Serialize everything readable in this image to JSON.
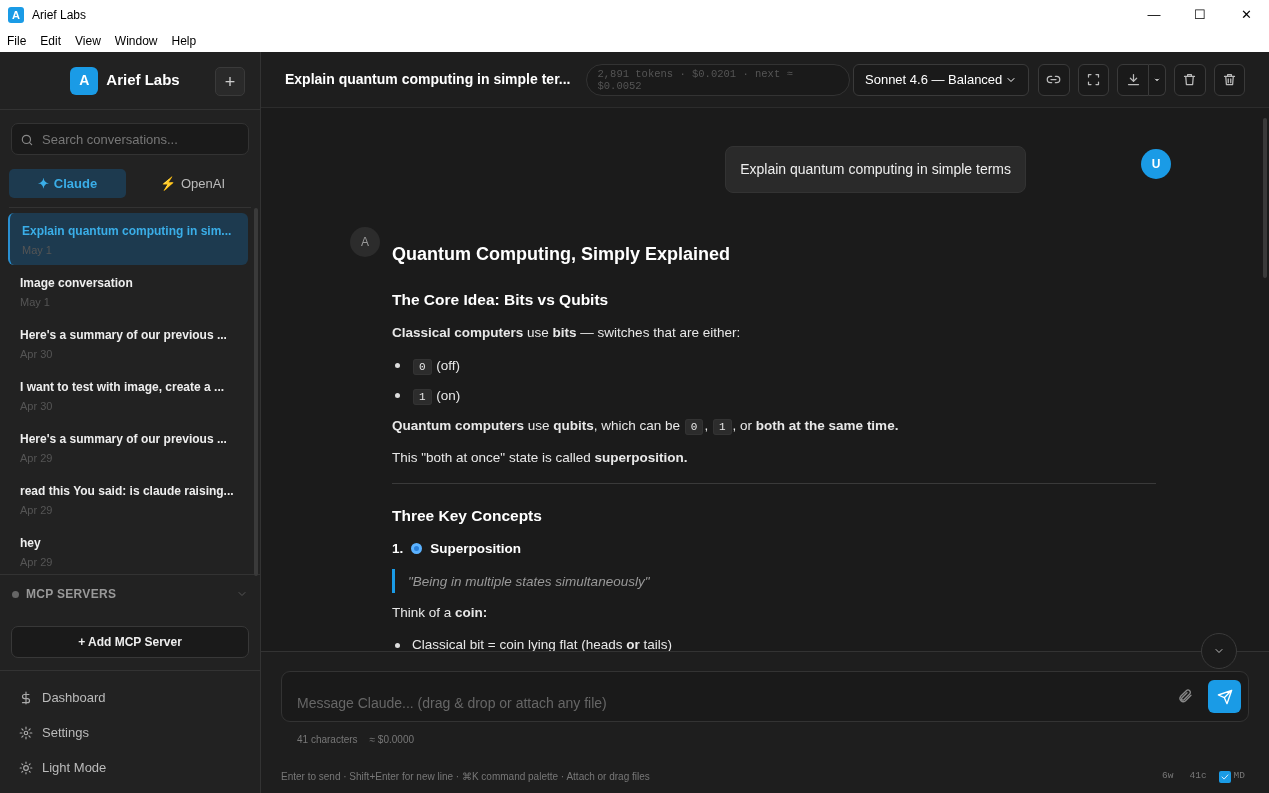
{
  "window": {
    "logo_letter": "A",
    "title": "Arief Labs",
    "controls": [
      "—",
      "☐",
      "✕"
    ]
  },
  "menu": [
    "File",
    "Edit",
    "View",
    "Window",
    "Help"
  ],
  "sidebar": {
    "brand": "Arief Labs",
    "brand_letter": "A",
    "new_button": "+",
    "search": {
      "placeholder": "Search conversations..."
    },
    "providers": [
      {
        "label": "Claude",
        "icon": "✦",
        "selected": true
      },
      {
        "label": "OpenAI",
        "icon": "⚡",
        "selected": false
      }
    ],
    "conversations": [
      {
        "title": "Explain quantum computing in sim...",
        "date": "May 1",
        "selected": true
      },
      {
        "title": "Image conversation",
        "date": "May 1",
        "selected": false
      },
      {
        "title": "Here's a summary of our previous ...",
        "date": "Apr 30",
        "selected": false
      },
      {
        "title": "I want to test with image, create a ...",
        "date": "Apr 30",
        "selected": false
      },
      {
        "title": "Here's a summary of our previous ...",
        "date": "Apr 29",
        "selected": false
      },
      {
        "title": "read this You said: is claude raising...",
        "date": "Apr 29",
        "selected": false
      },
      {
        "title": "hey",
        "date": "Apr 29",
        "selected": false
      }
    ],
    "mcp": {
      "label": "MCP SERVERS",
      "expanded": false,
      "add_button": "+ Add MCP Server"
    },
    "footer": [
      {
        "kind": "dollar",
        "label": "Dashboard"
      },
      {
        "kind": "gear",
        "label": "Settings"
      },
      {
        "kind": "sun",
        "label": "Light Mode"
      }
    ]
  },
  "header": {
    "title": "Explain quantum computing in simple ter...",
    "usage": "2,891 tokens · $0.0201 · next ≈ $0.0052",
    "model": "Sonnet 4.6 — Balanced"
  },
  "chat": {
    "user_message": {
      "avatar": "U",
      "text": "Explain quantum computing in simple terms"
    },
    "assistant": {
      "avatar": "A",
      "blocks": [
        {
          "kind": "h1",
          "parts": [
            {
              "kind": "text",
              "t": "Quantum Computing, Simply Explained"
            }
          ]
        },
        {
          "kind": "h2",
          "parts": [
            {
              "kind": "text",
              "t": "The Core Idea: Bits vs Qubits"
            }
          ]
        },
        {
          "kind": "p",
          "parts": [
            {
              "kind": "bold",
              "t": "Classical computers"
            },
            {
              "kind": "text",
              "t": " use "
            },
            {
              "kind": "bold",
              "t": "bits"
            },
            {
              "kind": "text",
              "t": " — switches that are either:"
            }
          ]
        },
        {
          "kind": "li",
          "parts": [
            {
              "kind": "code",
              "t": "0"
            },
            {
              "kind": "text",
              "t": " (off)"
            }
          ]
        },
        {
          "kind": "li",
          "parts": [
            {
              "kind": "code",
              "t": "1"
            },
            {
              "kind": "text",
              "t": " (on)"
            }
          ]
        },
        {
          "kind": "p",
          "parts": [
            {
              "kind": "bold",
              "t": "Quantum computers"
            },
            {
              "kind": "text",
              "t": " use "
            },
            {
              "kind": "bold",
              "t": "qubits"
            },
            {
              "kind": "text",
              "t": ", which can be "
            },
            {
              "kind": "code",
              "t": "0"
            },
            {
              "kind": "text",
              "t": ", "
            },
            {
              "kind": "code",
              "t": "1"
            },
            {
              "kind": "text",
              "t": ", or "
            },
            {
              "kind": "bold",
              "t": "both at the same time."
            }
          ]
        },
        {
          "kind": "p",
          "parts": [
            {
              "kind": "text",
              "t": "This \"both at once\" state is called "
            },
            {
              "kind": "bold",
              "t": "superposition."
            }
          ]
        },
        {
          "kind": "hr"
        },
        {
          "kind": "h2",
          "parts": [
            {
              "kind": "text",
              "t": "Three Key Concepts"
            }
          ]
        },
        {
          "kind": "h3",
          "parts": [
            {
              "kind": "bold",
              "t": "1."
            },
            {
              "kind": "orb"
            },
            {
              "kind": "bold",
              "t": "Superposition"
            }
          ]
        },
        {
          "kind": "quote",
          "parts": [
            {
              "kind": "text",
              "t": "\"Being in multiple states simultaneously\""
            }
          ]
        },
        {
          "kind": "p",
          "parts": [
            {
              "kind": "text",
              "t": "Think of a "
            },
            {
              "kind": "bold",
              "t": "coin:"
            }
          ]
        },
        {
          "kind": "li",
          "parts": [
            {
              "kind": "text",
              "t": "Classical bit = coin lying flat (heads "
            },
            {
              "kind": "bold",
              "t": "or"
            },
            {
              "kind": "text",
              "t": " tails)"
            }
          ]
        }
      ]
    }
  },
  "composer": {
    "placeholder": "Message Claude... (drag & drop or attach any file)",
    "char_count": "41 characters",
    "cost": "≈ $0.0000",
    "hint": "Enter to send · Shift+Enter for new line · ⌘K command palette · Attach or drag files",
    "words": "6w",
    "chars": "41c",
    "md": {
      "label": "MD",
      "checked": true
    }
  }
}
